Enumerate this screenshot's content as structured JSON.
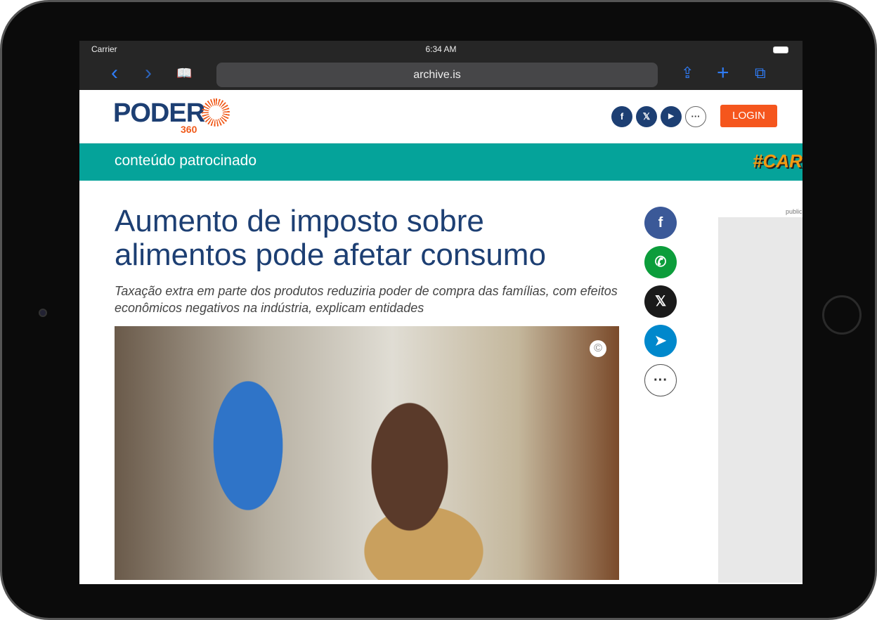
{
  "status": {
    "carrier": "Carrier",
    "time": "6:34 AM"
  },
  "browser": {
    "url": "archive.is",
    "back": "‹",
    "forward": "›",
    "bookmarks": "📖",
    "share": "⇪",
    "new_tab": "+",
    "tabs": "⧉"
  },
  "site": {
    "logo": "PODER",
    "logo_sub": "360",
    "social": [
      "f",
      "𝕏",
      "▶",
      "···"
    ],
    "login": "LOGIN",
    "band": "conteúdo patrocinado",
    "band_tag": "#CARI"
  },
  "article": {
    "title": "Aumento de imposto sobre alimentos pode afetar consumo",
    "subtitle": "Taxação extra em parte dos produtos reduziria poder de compra das famílias, com efeitos econômicos negativos na indústria, explicam entidades",
    "copyright": "©"
  },
  "share": [
    {
      "icon": "f",
      "color": "#3b5998"
    },
    {
      "icon": "✆",
      "color": "#0c9d3b"
    },
    {
      "icon": "𝕏",
      "color": "#1a1a1a"
    },
    {
      "icon": "➤",
      "color": "#0088cc"
    },
    {
      "icon": "···",
      "color": "#ffffff"
    }
  ],
  "ad": {
    "label": "publicidade"
  }
}
